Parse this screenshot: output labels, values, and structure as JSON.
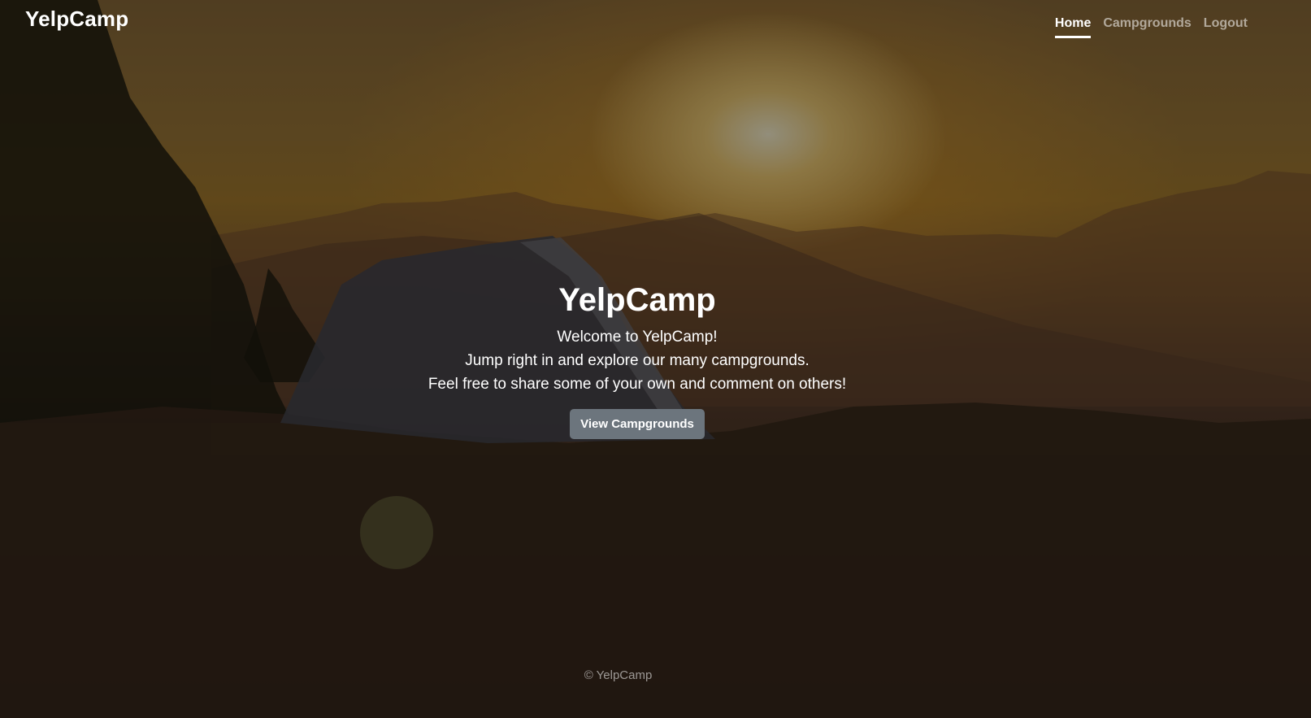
{
  "nav": {
    "brand": "YelpCamp",
    "links": [
      {
        "label": "Home",
        "active": true
      },
      {
        "label": "Campgrounds",
        "active": false
      },
      {
        "label": "Logout",
        "active": false
      }
    ]
  },
  "hero": {
    "title": "YelpCamp",
    "lead_lines": [
      "Welcome to YelpCamp!",
      "Jump right in and explore our many campgrounds.",
      "Feel free to share some of your own and comment on others!"
    ],
    "button_label": "View Campgrounds"
  },
  "footer": {
    "copyright": "© YelpCamp"
  },
  "colors": {
    "button_bg": "#6c757d",
    "text": "#ffffff",
    "muted_link": "rgba(255,255,255,0.55)"
  }
}
